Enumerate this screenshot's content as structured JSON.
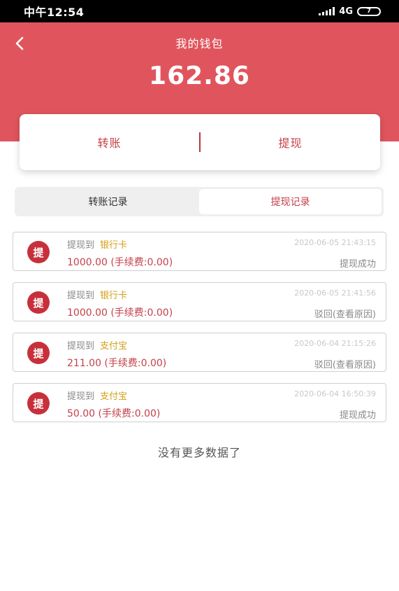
{
  "statusbar": {
    "time": "中午12:54",
    "network": "4G",
    "battery": "7"
  },
  "header": {
    "title": "我的钱包",
    "balance": "162.86"
  },
  "actions": {
    "transfer_label": "转账",
    "withdraw_label": "提现"
  },
  "tabs": [
    {
      "label": "转账记录",
      "active": false
    },
    {
      "label": "提现记录",
      "active": true
    }
  ],
  "records": [
    {
      "icon": "提",
      "prefix": "提现到",
      "target": "银行卡",
      "time": "2020-06-05 21:43:15",
      "amount": "1000.00 (手续费:0.00)",
      "status": "提现成功"
    },
    {
      "icon": "提",
      "prefix": "提现到",
      "target": "银行卡",
      "time": "2020-06-05 21:41:56",
      "amount": "1000.00 (手续费:0.00)",
      "status": "驳回(查看原因)"
    },
    {
      "icon": "提",
      "prefix": "提现到",
      "target": "支付宝",
      "time": "2020-06-04 21:15:26",
      "amount": "211.00 (手续费:0.00)",
      "status": "驳回(查看原因)"
    },
    {
      "icon": "提",
      "prefix": "提现到",
      "target": "支付宝",
      "time": "2020-06-04 16:50:39",
      "amount": "50.00 (手续费:0.00)",
      "status": "提现成功"
    }
  ],
  "footer": {
    "no_more": "没有更多数据了"
  },
  "colors": {
    "header": "#e0555d",
    "accent": "#c3414a",
    "target": "#d4a017"
  }
}
